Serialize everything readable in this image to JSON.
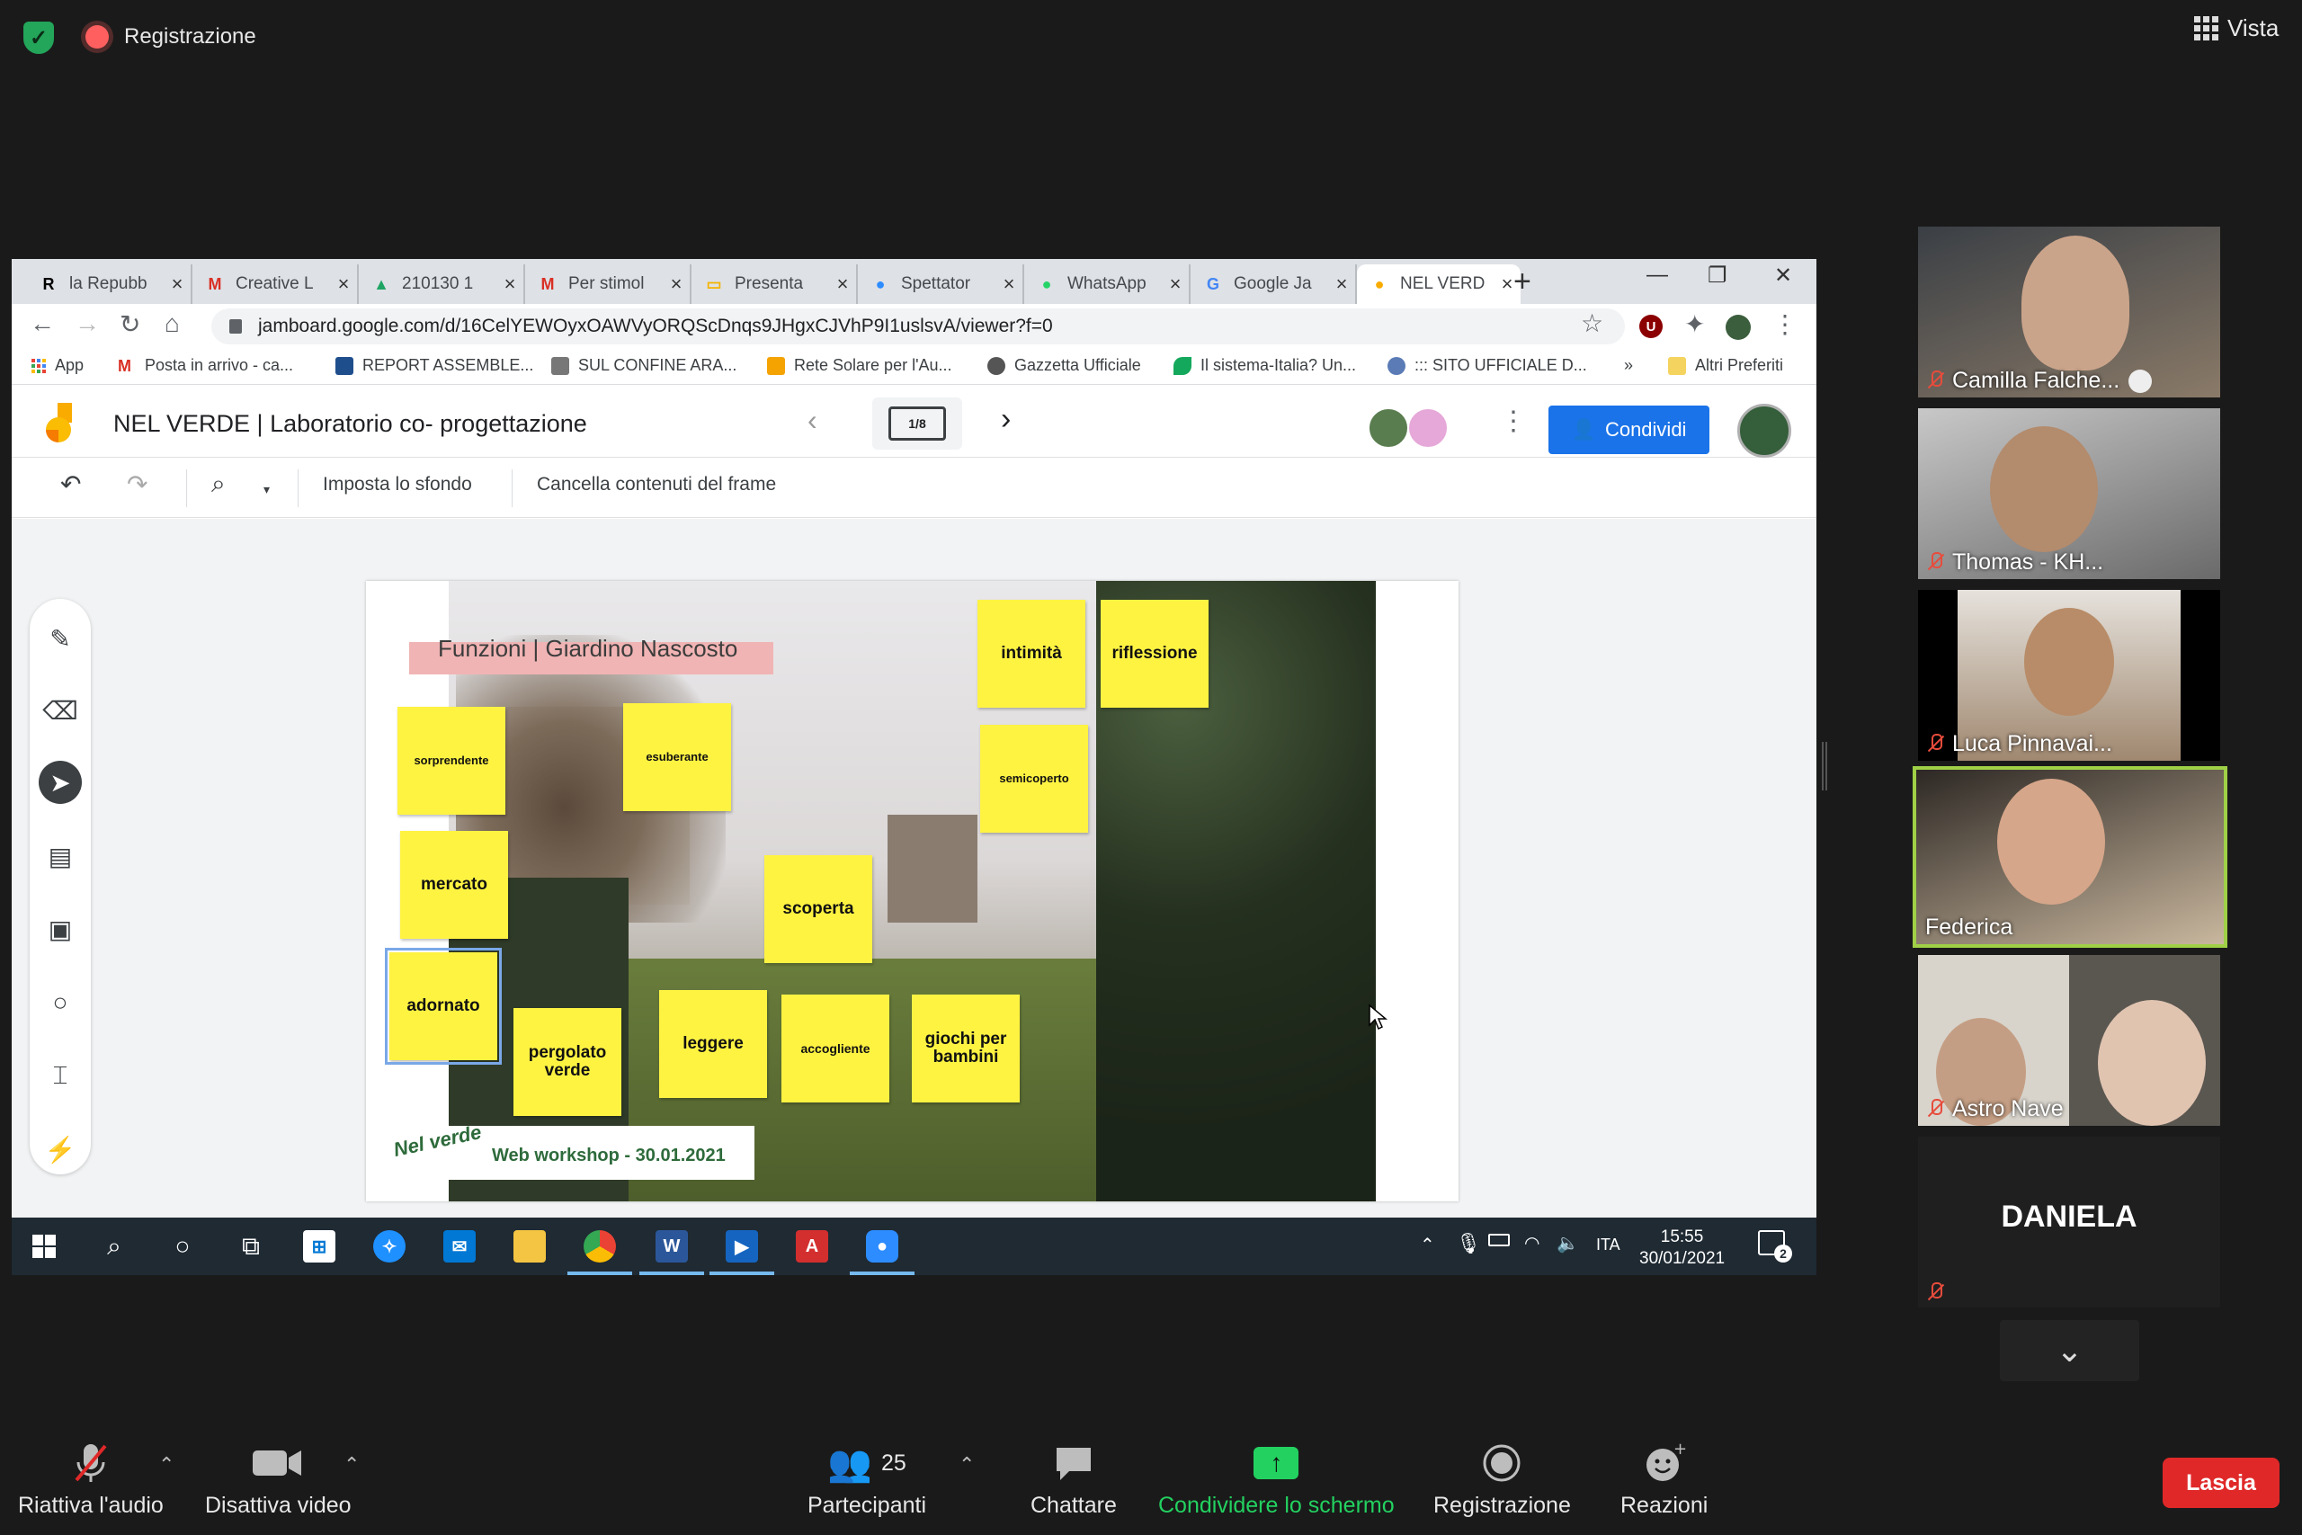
{
  "zoom_top": {
    "recording_label": "Registrazione",
    "view_label": "Vista"
  },
  "browser": {
    "tabs": [
      {
        "label": "la Repubb",
        "icon": "R",
        "color": "#000000"
      },
      {
        "label": "Creative L",
        "icon": "M",
        "color": "#d93025"
      },
      {
        "label": "210130 1",
        "icon": "▲",
        "color": "#1fa463"
      },
      {
        "label": "Per stimol",
        "icon": "M",
        "color": "#d93025"
      },
      {
        "label": "Presenta",
        "icon": "▭",
        "color": "#f4b400"
      },
      {
        "label": "Spettator",
        "icon": "●",
        "color": "#2d8cff"
      },
      {
        "label": "WhatsApp",
        "icon": "●",
        "color": "#25d366"
      },
      {
        "label": "Google Ja",
        "icon": "G",
        "color": "#4285f4"
      },
      {
        "label": "NEL VERD",
        "icon": "●",
        "color": "#f9ab00"
      }
    ],
    "new_tab": "+",
    "url": "jamboard.google.com/d/16CelYEWOyxOAWVyORQScDnqs9JHgxCJVhP9I1uslsvA/viewer?f=0",
    "bookmarks": [
      {
        "label": "App"
      },
      {
        "label": "Posta in arrivo - ca..."
      },
      {
        "label": "REPORT ASSEMBLE..."
      },
      {
        "label": "SUL CONFINE ARA..."
      },
      {
        "label": "Rete Solare per l'Au..."
      },
      {
        "label": "Gazzetta Ufficiale"
      },
      {
        "label": "Il sistema-Italia? Un..."
      },
      {
        "label": "::: SITO UFFICIALE D..."
      }
    ],
    "bookmarks_more": "»",
    "other_bookmarks": "Altri Preferiti"
  },
  "jamboard": {
    "title": "NEL VERDE | Laboratorio co- progettazione",
    "frame_indicator": "1/8",
    "share_label": "Condividi",
    "toolbar": {
      "set_background": "Imposta lo sfondo",
      "clear_frame": "Cancella contenuti del frame"
    },
    "frame_title": "Funzioni | Giardino Nascosto",
    "notes": [
      {
        "text": "intimità"
      },
      {
        "text": "riflessione"
      },
      {
        "text": "sorprendente"
      },
      {
        "text": "esuberante"
      },
      {
        "text": "semicoperto"
      },
      {
        "text": "mercato"
      },
      {
        "text": "scoperta"
      },
      {
        "text": "adornato"
      },
      {
        "text": "pergolato verde"
      },
      {
        "text": "leggere"
      },
      {
        "text": "accogliente"
      },
      {
        "text": "giochi per bambini"
      }
    ],
    "logo_text": "Nel verde",
    "workshop_text": "Web workshop  -  30.01.2021"
  },
  "taskbar": {
    "lang": "ITA",
    "time": "15:55",
    "date": "30/01/2021",
    "notifications": "2"
  },
  "participants_gallery": [
    {
      "name": "Camilla Falche..."
    },
    {
      "name": "Thomas - KH..."
    },
    {
      "name": "Luca Pinnavai..."
    },
    {
      "name": "Federica"
    },
    {
      "name": "Astro Nave"
    },
    {
      "name": "DANIELA"
    }
  ],
  "zoom_bottom": {
    "unmute": "Riattiva l'audio",
    "stop_video": "Disattiva video",
    "participants": "Partecipanti",
    "participants_count": "25",
    "chat": "Chattare",
    "share_screen": "Condividere lo schermo",
    "record": "Registrazione",
    "reactions": "Reazioni",
    "leave": "Lascia"
  },
  "colors": {
    "note_yellow": "#fff342",
    "share_green": "#23d160",
    "leave_red": "#e02828",
    "jam_blue": "#1a73e8"
  }
}
